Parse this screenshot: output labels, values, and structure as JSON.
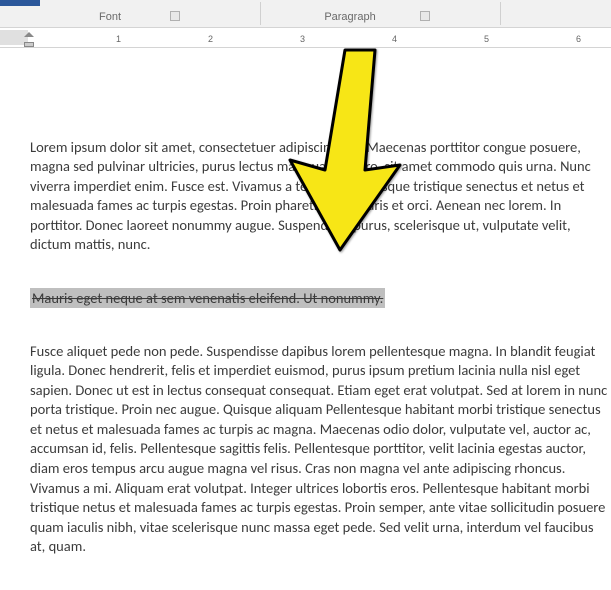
{
  "ribbon": {
    "groups": {
      "font": "Font",
      "paragraph": "Paragraph",
      "styles_hint": ""
    }
  },
  "ruler": {
    "numbers": [
      "1",
      "2",
      "3",
      "4",
      "5",
      "6"
    ]
  },
  "document": {
    "para1": "Lorem ipsum dolor sit amet, consectetuer adipiscing elit. Maecenas porttitor congue posuere, magna sed pulvinar ultricies, purus lectus malesuada libero, sit amet commodo quis urna. Nunc viverra imperdiet enim. Fusce est. Vivamus a tellus. Pellentesque tristique senectus et netus et malesuada fames ac turpis egestas. Proin pharetra no Mauris et orci. Aenean nec lorem. In porttitor. Donec laoreet nonummy augue. Suspendisse purus, scelerisque ut, vulputate velit, dictum mattis, nunc.",
    "selected_text": "Mauris eget neque at sem venenatis eleifend. Ut nonummy.",
    "para3": " Fusce aliquet pede non pede. Suspendisse dapibus lorem pellentesque magna. In blandit feugiat ligula. Donec hendrerit, felis et imperdiet euismod, purus ipsum pretium lacinia nulla nisl eget sapien. Donec ut est in lectus consequat consequat. Etiam eget erat volutpat. Sed at lorem in nunc porta tristique. Proin nec augue. Quisque aliquam Pellentesque habitant morbi tristique senectus et netus et malesuada fames ac turpis ac magna. Maecenas odio dolor, vulputate vel, auctor ac, accumsan id, felis. Pellentesque sagittis felis. Pellentesque porttitor, velit lacinia egestas auctor, diam eros tempus arcu augue magna vel risus. Cras non magna vel ante adipiscing rhoncus. Vivamus a mi. Aliquam erat volutpat. Integer ultrices lobortis eros. Pellentesque habitant morbi tristique netus et malesuada fames ac turpis egestas. Proin semper, ante vitae sollicitudin posuere quam iaculis nibh, vitae scelerisque nunc massa eget pede. Sed velit urna, interdum vel faucibus at, quam."
  }
}
